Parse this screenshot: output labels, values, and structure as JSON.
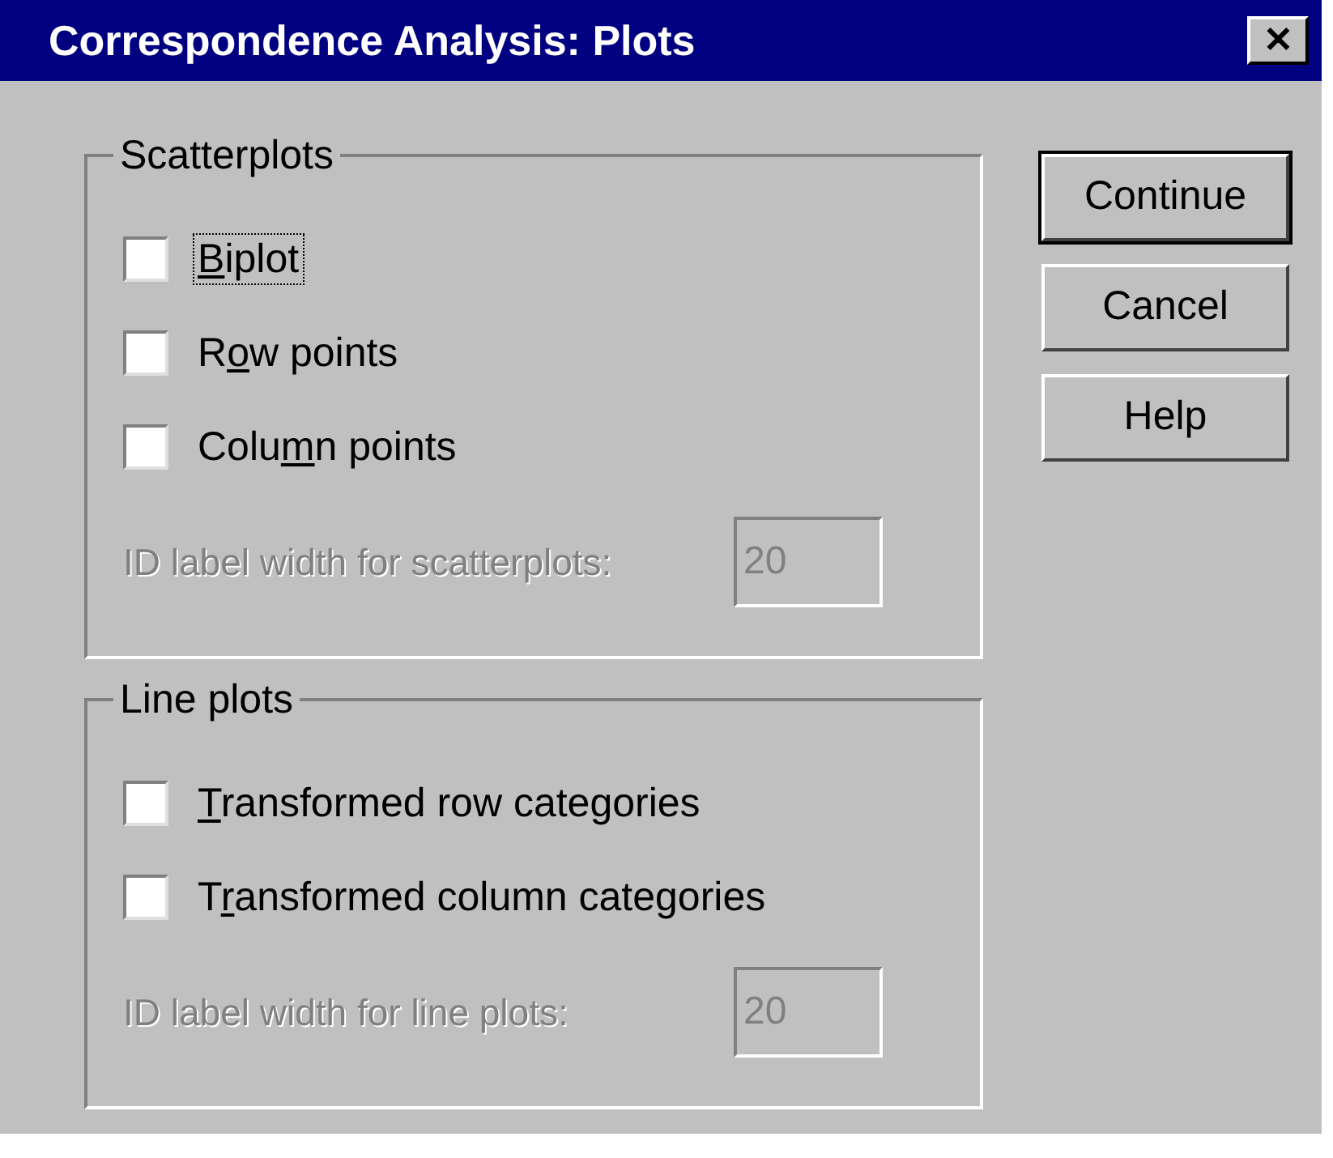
{
  "window": {
    "title": "Correspondence Analysis: Plots",
    "close": "✕"
  },
  "groups": [
    {
      "title": "Scatterplots",
      "options": [
        {
          "label": [
            {
              "text": "B",
              "underline": true
            },
            {
              "text": "iplot",
              "underline": false
            }
          ],
          "checked": false,
          "focused": true
        },
        {
          "label": [
            {
              "text": "R",
              "underline": false
            },
            {
              "text": "o",
              "underline": true
            },
            {
              "text": "w points",
              "underline": false
            }
          ],
          "checked": false,
          "focused": false
        },
        {
          "label": [
            {
              "text": "Colu",
              "underline": false
            },
            {
              "text": "m",
              "underline": true
            },
            {
              "text": "n points",
              "underline": false
            }
          ],
          "checked": false,
          "focused": false
        }
      ],
      "field": {
        "label": "ID label width for scatterplots:",
        "value": "20",
        "disabled": true
      }
    },
    {
      "title": "Line plots",
      "options": [
        {
          "label": [
            {
              "text": "T",
              "underline": true
            },
            {
              "text": "ransformed row categories",
              "underline": false
            }
          ],
          "checked": false,
          "focused": false
        },
        {
          "label": [
            {
              "text": "T",
              "underline": false
            },
            {
              "text": "r",
              "underline": true
            },
            {
              "text": "ansformed column categories",
              "underline": false
            }
          ],
          "checked": false,
          "focused": false
        }
      ],
      "field": {
        "label": "ID label width for line plots:",
        "value": "20",
        "disabled": true
      }
    }
  ],
  "buttons": [
    {
      "label": "Continue",
      "default": true
    },
    {
      "label": "Cancel",
      "default": false
    },
    {
      "label": "Help",
      "default": false
    }
  ]
}
